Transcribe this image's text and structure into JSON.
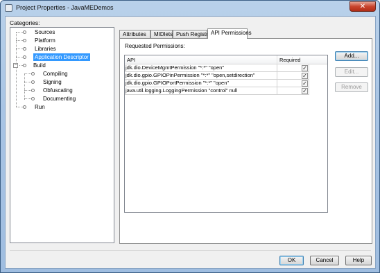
{
  "window": {
    "title": "Project Properties - JavaMEDemos",
    "close_label": "✕"
  },
  "categories": {
    "label": "Categories:",
    "items": [
      {
        "label": "Sources"
      },
      {
        "label": "Platform"
      },
      {
        "label": "Libraries"
      },
      {
        "label": "Application Descriptor",
        "selected": true
      },
      {
        "label": "Build",
        "expander": "−"
      },
      {
        "label": "Compiling"
      },
      {
        "label": "Signing"
      },
      {
        "label": "Obfuscating"
      },
      {
        "label": "Documenting"
      },
      {
        "label": "Run"
      }
    ]
  },
  "tabs": [
    {
      "label": "Attributes"
    },
    {
      "label": "MIDlets"
    },
    {
      "label": "Push Registry"
    },
    {
      "label": "API Permissions",
      "active": true
    }
  ],
  "permissions": {
    "section_label": "Requested Permissions:",
    "columns": {
      "api": "API",
      "required": "Required"
    },
    "rows": [
      {
        "api": "jdk.dio.DeviceMgmtPermission \"*:*\" \"open\"",
        "required": true
      },
      {
        "api": "jdk.dio.gpio.GPIOPinPermission \"*:*\" \"open,setdirection\"",
        "required": true
      },
      {
        "api": "jdk.dio.gpio.GPIOPortPermission \"*:*\" \"open\"",
        "required": true
      },
      {
        "api": "java.util.logging.LoggingPermission \"control\" null",
        "required": true
      }
    ],
    "check_glyph": "✓"
  },
  "side_buttons": {
    "add": "Add...",
    "edit": "Edit...",
    "remove": "Remove"
  },
  "footer": {
    "ok": "OK",
    "cancel": "Cancel",
    "help": "Help"
  }
}
